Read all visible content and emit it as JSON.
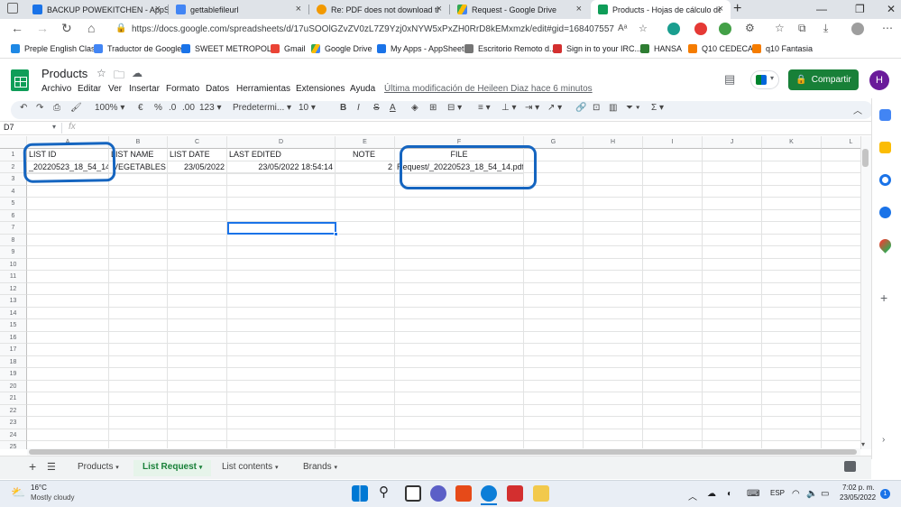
{
  "browser": {
    "tabs": [
      {
        "title": "BACKUP POWEKITCHEN - AppSh",
        "color": "#1a73e8"
      },
      {
        "title": "gettablefileurl",
        "color": "#4285f4"
      },
      {
        "title": "Re: PDF does not download the",
        "color": "#f29900"
      },
      {
        "title": "Request - Google Drive",
        "color": "#34a853"
      },
      {
        "title": "Products - Hojas de cálculo de G",
        "color": "#0f9d58"
      }
    ],
    "url": "https://docs.google.com/spreadsheets/d/17uSOOlGZvZV0zL7Z9Yzj0xNYW5xPxZH0RrD8kEMxmzk/edit#gid=168407557",
    "bookmarks": [
      "Preple English Class",
      "Traductor de Google",
      "SWEET METROPOLI...",
      "Gmail",
      "Google Drive",
      "My Apps - AppSheet",
      "Escritorio Remoto d...",
      "Sign in to your IRC...",
      "HANSA",
      "Q10 CEDECA",
      "q10 Fantasia"
    ]
  },
  "sheets": {
    "doc_title": "Products",
    "menus": [
      "Archivo",
      "Editar",
      "Ver",
      "Insertar",
      "Formato",
      "Datos",
      "Herramientas",
      "Extensiones",
      "Ayuda"
    ],
    "last_edit": "Última modificación de Heileen Diaz hace 6 minutos",
    "share_label": "Compartir",
    "avatar_letter": "H",
    "toolbar": {
      "zoom": "100%",
      "currency": "€",
      "percent": "%",
      "dec_less": ".0",
      "dec_more": ".00",
      "more_formats": "123",
      "font": "Predetermi...",
      "font_size": "10"
    },
    "name_box": "D7",
    "fx": "fx",
    "columns": [
      "A",
      "B",
      "C",
      "D",
      "E",
      "F",
      "G",
      "H",
      "I",
      "J",
      "K",
      "L"
    ],
    "rows": [
      "1",
      "2",
      "3",
      "4",
      "5",
      "6",
      "7",
      "8",
      "9",
      "10",
      "11",
      "12",
      "13",
      "14",
      "15",
      "16",
      "17",
      "18",
      "19",
      "20",
      "21",
      "22",
      "23",
      "24",
      "25"
    ],
    "cells": {
      "A1": "LIST ID",
      "B1": "LIST NAME",
      "C1": "LIST DATE",
      "D1": "LAST EDITED",
      "E1": "NOTE",
      "F1": "FILE",
      "A2": "_20220523_18_54_14",
      "B2": "VEGETABLES",
      "C2": "23/05/2022",
      "D2": "23/05/2022 18:54:14",
      "E2": "2",
      "F2": "Request/_20220523_18_54_14.pdf"
    },
    "sheet_tabs": [
      "Products",
      "List Request",
      "List contents",
      "Brands"
    ],
    "active_sheet": "List Request"
  },
  "taskbar": {
    "weather_temp": "16°C",
    "weather_desc": "Mostly cloudy",
    "lang": "ESP",
    "time": "7:02 p. m.",
    "date": "23/05/2022"
  },
  "colors": {
    "sheets_green": "#188038",
    "annotation_blue": "#1565c0",
    "selection_blue": "#1a73e8"
  }
}
